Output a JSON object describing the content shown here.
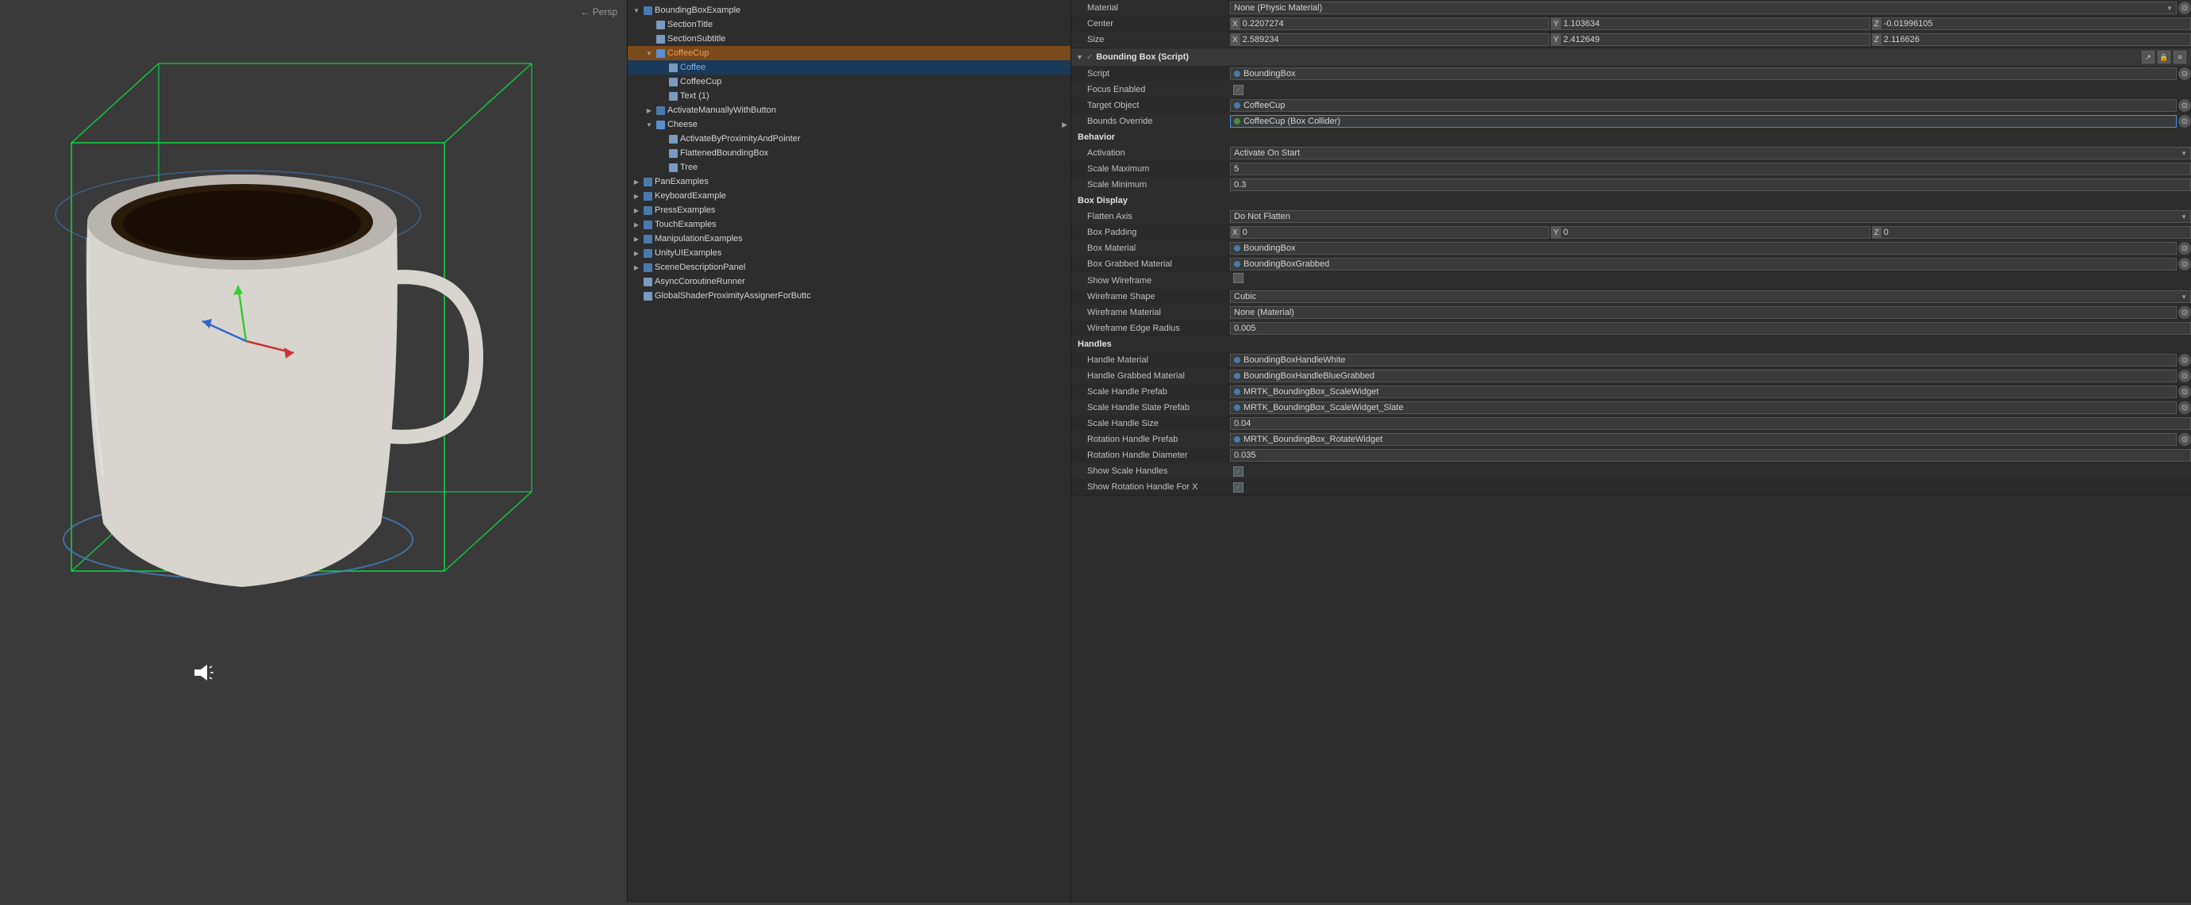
{
  "viewport": {
    "label": "← Persp"
  },
  "hierarchy": {
    "items": [
      {
        "id": "bounding-box-example",
        "indent": 0,
        "arrow": "down",
        "icon": "cube",
        "name": "BoundingBoxExample",
        "state": ""
      },
      {
        "id": "section-title",
        "indent": 1,
        "arrow": "empty",
        "icon": "cube-small",
        "name": "SectionTitle",
        "state": ""
      },
      {
        "id": "section-subtitle",
        "indent": 1,
        "arrow": "empty",
        "icon": "cube-small",
        "name": "SectionSubtitle",
        "state": ""
      },
      {
        "id": "coffee-cup",
        "indent": 1,
        "arrow": "down",
        "icon": "prefab",
        "name": "CoffeeCup",
        "state": "selected-orange"
      },
      {
        "id": "coffee",
        "indent": 2,
        "arrow": "empty",
        "icon": "cube-small",
        "name": "Coffee",
        "state": "selected-blue"
      },
      {
        "id": "coffee-cup-2",
        "indent": 2,
        "arrow": "empty",
        "icon": "cube-small",
        "name": "CoffeeCup",
        "state": ""
      },
      {
        "id": "text-1",
        "indent": 2,
        "arrow": "empty",
        "icon": "cube-small",
        "name": "Text (1)",
        "state": ""
      },
      {
        "id": "activate-manually",
        "indent": 1,
        "arrow": "right",
        "icon": "cube",
        "name": "ActivateManuallyWithButton",
        "state": ""
      },
      {
        "id": "cheese",
        "indent": 1,
        "arrow": "down",
        "icon": "prefab",
        "name": "Cheese",
        "state": "",
        "hasArrow": true
      },
      {
        "id": "activate-proximity",
        "indent": 2,
        "arrow": "empty",
        "icon": "cube-small",
        "name": "ActivateByProximityAndPointer",
        "state": ""
      },
      {
        "id": "flattened",
        "indent": 2,
        "arrow": "empty",
        "icon": "cube-small",
        "name": "FlattenedBoundingBox",
        "state": ""
      },
      {
        "id": "tree",
        "indent": 2,
        "arrow": "empty",
        "icon": "cube-small",
        "name": "Tree",
        "state": ""
      },
      {
        "id": "pan-examples",
        "indent": 0,
        "arrow": "right",
        "icon": "cube",
        "name": "PanExamples",
        "state": ""
      },
      {
        "id": "keyboard-example",
        "indent": 0,
        "arrow": "right",
        "icon": "cube",
        "name": "KeyboardExample",
        "state": ""
      },
      {
        "id": "press-examples",
        "indent": 0,
        "arrow": "right",
        "icon": "cube",
        "name": "PressExamples",
        "state": ""
      },
      {
        "id": "touch-examples",
        "indent": 0,
        "arrow": "right",
        "icon": "cube",
        "name": "TouchExamples",
        "state": ""
      },
      {
        "id": "manipulation-examples",
        "indent": 0,
        "arrow": "right",
        "icon": "cube",
        "name": "ManipulationExamples",
        "state": ""
      },
      {
        "id": "unityui-examples",
        "indent": 0,
        "arrow": "right",
        "icon": "cube",
        "name": "UnityUIExamples",
        "state": ""
      },
      {
        "id": "scene-description",
        "indent": 0,
        "arrow": "right",
        "icon": "cube",
        "name": "SceneDescriptionPanel",
        "state": ""
      },
      {
        "id": "async-runner",
        "indent": 0,
        "arrow": "empty",
        "icon": "cube-small",
        "name": "AsyncCoroutineRunner",
        "state": ""
      },
      {
        "id": "global-shader",
        "indent": 0,
        "arrow": "empty",
        "icon": "cube-small",
        "name": "GlobalShaderProximityAssignerForButtc",
        "state": ""
      }
    ]
  },
  "inspector": {
    "component_title": "Bounding Box (Script)",
    "fields": {
      "script": {
        "label": "Script",
        "value": "BoundingBox"
      },
      "focus_enabled": {
        "label": "Focus Enabled",
        "checked": true
      },
      "target_object": {
        "label": "Target Object",
        "value": "CoffeeCup",
        "dot": "blue"
      },
      "bounds_override": {
        "label": "Bounds Override",
        "value": "CoffeeCup (Box Collider)",
        "dot": "green",
        "highlighted": true
      }
    },
    "behavior": {
      "section_label": "Behavior",
      "activation": {
        "label": "Activation",
        "value": "Activate On Start"
      },
      "scale_maximum": {
        "label": "Scale Maximum",
        "value": "5"
      },
      "scale_minimum": {
        "label": "Scale Minimum",
        "value": "0.3"
      }
    },
    "box_display": {
      "section_label": "Box Display",
      "flatten_axis": {
        "label": "Flatten Axis",
        "value": "Do Not Flatten"
      },
      "box_padding": {
        "label": "Box Padding",
        "x": "0",
        "y": "0",
        "z": "0"
      },
      "box_material": {
        "label": "Box Material",
        "value": "BoundingBox",
        "dot": "blue"
      },
      "box_grabbed_material": {
        "label": "Box Grabbed Material",
        "value": "BoundingBoxGrabbed",
        "dot": "blue"
      },
      "show_wireframe": {
        "label": "Show Wireframe",
        "checked": false
      },
      "wireframe_shape": {
        "label": "Wireframe Shape",
        "value": "Cubic"
      },
      "wireframe_material": {
        "label": "Wireframe Material",
        "value": "None (Material)"
      },
      "wireframe_edge_radius": {
        "label": "Wireframe Edge Radius",
        "value": "0.005"
      }
    },
    "handles": {
      "section_label": "Handles",
      "handle_material": {
        "label": "Handle Material",
        "value": "BoundingBoxHandleWhite",
        "dot": "blue"
      },
      "handle_grabbed_material": {
        "label": "Handle Grabbed Material",
        "value": "BoundingBoxHandleBlueGrabbed",
        "dot": "blue"
      },
      "scale_handle_prefab": {
        "label": "Scale Handle Prefab",
        "value": "MRTK_BoundingBox_ScaleWidget",
        "dot": "blue"
      },
      "scale_handle_slate_prefab": {
        "label": "Scale Handle Slate Prefab",
        "value": "MRTK_BoundingBox_ScaleWidget_Slate",
        "dot": "blue"
      },
      "scale_handle_size": {
        "label": "Scale Handle Size",
        "value": "0.04"
      },
      "rotation_handle_prefab": {
        "label": "Rotation Handle Prefab",
        "value": "MRTK_BoundingBox_RotateWidget",
        "dot": "blue"
      },
      "rotation_handle_diameter": {
        "label": "Rotation Handle Diameter",
        "value": "0.035"
      },
      "show_scale_handles": {
        "label": "Show Scale Handles",
        "checked": true
      },
      "show_rotation_handle_x": {
        "label": "Show Rotation Handle For X",
        "checked": true
      }
    },
    "top_props": {
      "material_label": "Material",
      "material_value": "None (Physic Material)",
      "center_label": "Center",
      "center_x": "0.2207274",
      "center_y": "1.103634",
      "center_z": "-0.01996105",
      "size_label": "Size",
      "size_x": "2.589234",
      "size_y": "2.412649",
      "size_z": "2.116626"
    }
  }
}
